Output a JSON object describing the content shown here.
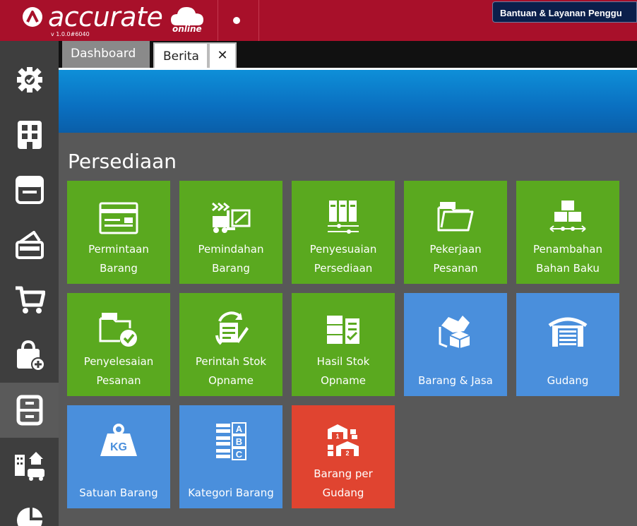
{
  "app": {
    "name": "accurate",
    "suffix": "online",
    "version": "v 1.0.0#6040"
  },
  "header": {
    "help_label": "Bantuan & Layanan Penggu"
  },
  "tabs": [
    {
      "label": "Dashboard"
    },
    {
      "label": "Berita"
    },
    {
      "label": "✕"
    }
  ],
  "sidebar": {
    "items": [
      {
        "icon": "gear-icon"
      },
      {
        "icon": "building-icon"
      },
      {
        "icon": "ledger-icon"
      },
      {
        "icon": "wallet-icon"
      },
      {
        "icon": "cart-icon"
      },
      {
        "icon": "shopping-bag-add-icon"
      },
      {
        "icon": "cabinet-icon",
        "active": true
      },
      {
        "icon": "company-car-icon"
      },
      {
        "icon": "pie-chart-icon"
      }
    ]
  },
  "section": {
    "title": "Persediaan"
  },
  "tiles": [
    {
      "label": "Permintaan\nBarang",
      "color": "#5aa91f",
      "icon": "request-form-icon"
    },
    {
      "label": "Pemindahan\nBarang",
      "color": "#5aa91f",
      "icon": "forklift-icon"
    },
    {
      "label": "Penyesuaian\nPersediaan",
      "color": "#5aa91f",
      "icon": "binders-slider-icon"
    },
    {
      "label": "Pekerjaan\nPesanan",
      "color": "#5aa91f",
      "icon": "job-folder-icon"
    },
    {
      "label": "Penambahan\nBahan Baku",
      "color": "#5aa91f",
      "icon": "stacked-boxes-icon"
    },
    {
      "label": "Penyelesaian\nPesanan",
      "color": "#5aa91f",
      "icon": "job-folder-check-icon"
    },
    {
      "label": "Perintah Stok\nOpname",
      "color": "#5aa91f",
      "icon": "stock-order-icon"
    },
    {
      "label": "Hasil Stok\nOpname",
      "color": "#5aa91f",
      "icon": "stock-result-icon"
    },
    {
      "label": "Barang & Jasa",
      "color": "#4a8fdc",
      "icon": "goods-services-icon"
    },
    {
      "label": "Gudang",
      "color": "#4a8fdc",
      "icon": "warehouse-icon"
    },
    {
      "label": "Satuan Barang",
      "color": "#4a8fdc",
      "icon": "weight-kg-icon",
      "icon_text": "KG"
    },
    {
      "label": "Kategori Barang",
      "color": "#4a8fdc",
      "icon": "category-abc-icon",
      "icon_text": [
        "A",
        "B",
        "C"
      ]
    },
    {
      "label": "Barang per\nGudang",
      "color": "#e04430",
      "icon": "warehouse-goods-icon",
      "icon_text": [
        "1",
        "2"
      ]
    }
  ],
  "colors": {
    "topbar": "#a8102a",
    "sidebar": "#3e3e3e",
    "content": "#585858",
    "green": "#5aa91f",
    "blue": "#4a8fdc",
    "red": "#e04430"
  }
}
